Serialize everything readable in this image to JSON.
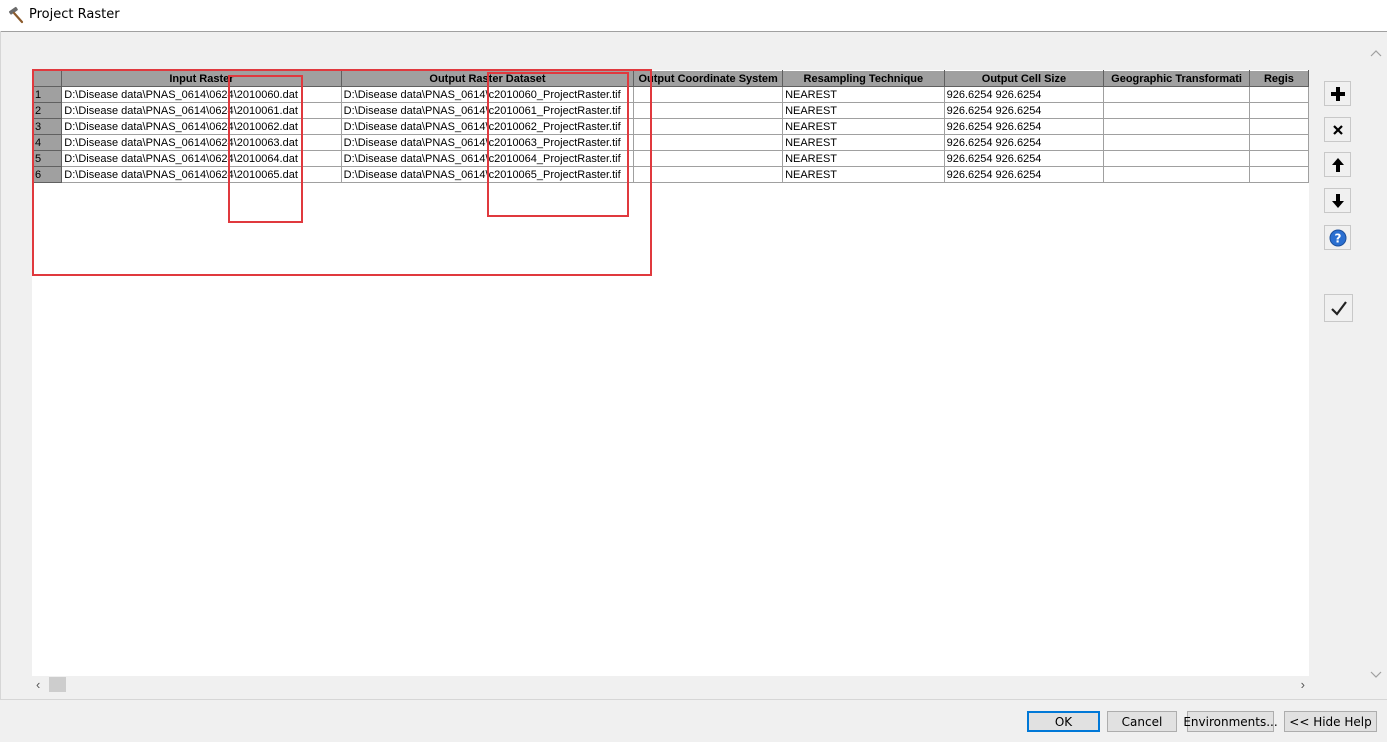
{
  "window": {
    "title": "Project Raster"
  },
  "grid": {
    "columns": [
      "Input Raster",
      "Output Raster Dataset",
      "Output Coordinate System",
      "Resampling Technique",
      "Output Cell Size",
      "Geographic Transformati",
      "Regis"
    ],
    "rows": [
      {
        "num": "1",
        "input": "D:\\Disease data\\PNAS_0614\\0624\\2010060.dat",
        "output": "D:\\Disease data\\PNAS_0614\\c2010060_ProjectRaster.tif",
        "coord": "",
        "resampling": "NEAREST",
        "cellsize": "926.6254 926.6254",
        "geo": "",
        "regis": ""
      },
      {
        "num": "2",
        "input": "D:\\Disease data\\PNAS_0614\\0624\\2010061.dat",
        "output": "D:\\Disease data\\PNAS_0614\\c2010061_ProjectRaster.tif",
        "coord": "",
        "resampling": "NEAREST",
        "cellsize": "926.6254 926.6254",
        "geo": "",
        "regis": ""
      },
      {
        "num": "3",
        "input": "D:\\Disease data\\PNAS_0614\\0624\\2010062.dat",
        "output": "D:\\Disease data\\PNAS_0614\\c2010062_ProjectRaster.tif",
        "coord": "",
        "resampling": "NEAREST",
        "cellsize": "926.6254 926.6254",
        "geo": "",
        "regis": ""
      },
      {
        "num": "4",
        "input": "D:\\Disease data\\PNAS_0614\\0624\\2010063.dat",
        "output": "D:\\Disease data\\PNAS_0614\\c2010063_ProjectRaster.tif",
        "coord": "",
        "resampling": "NEAREST",
        "cellsize": "926.6254 926.6254",
        "geo": "",
        "regis": ""
      },
      {
        "num": "5",
        "input": "D:\\Disease data\\PNAS_0614\\0624\\2010064.dat",
        "output": "D:\\Disease data\\PNAS_0614\\c2010064_ProjectRaster.tif",
        "coord": "",
        "resampling": "NEAREST",
        "cellsize": "926.6254 926.6254",
        "geo": "",
        "regis": ""
      },
      {
        "num": "6",
        "input": "D:\\Disease data\\PNAS_0614\\0624\\2010065.dat",
        "output": "D:\\Disease data\\PNAS_0614\\c2010065_ProjectRaster.tif",
        "coord": "",
        "resampling": "NEAREST",
        "cellsize": "926.6254 926.6254",
        "geo": "",
        "regis": ""
      }
    ]
  },
  "side_buttons": {
    "add": "plus-icon",
    "remove": "close-icon",
    "up": "arrow-up-icon",
    "down": "arrow-down-icon",
    "help": "help-icon",
    "check": "check-icon"
  },
  "footer": {
    "ok": "OK",
    "cancel": "Cancel",
    "environments": "Environments...",
    "hide_help": "<< Hide Help"
  },
  "colors": {
    "annotation_red": "#e0393e",
    "header_gray": "#a0a0a0",
    "help_blue": "#2a6fd1",
    "default_button_border": "#0078d7"
  }
}
